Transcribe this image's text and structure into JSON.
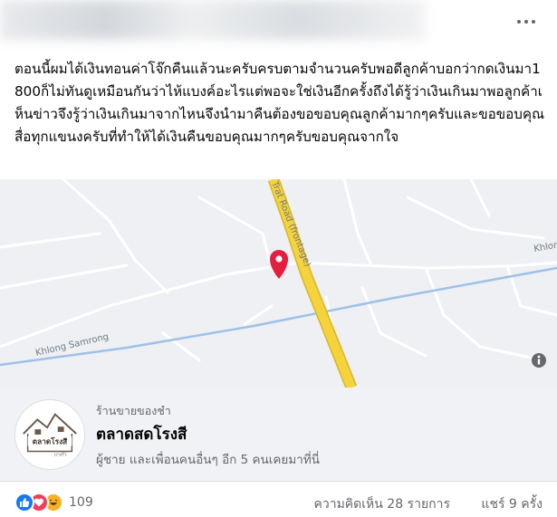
{
  "post": {
    "text": "ตอนนี้ผมได้เงินทอนค่าโจ๊กคืนแล้วนะครับครบตามจำนวนครับพอดีลูกค้าบอกว่ากดเงินมา1800ก็ไม่ทันดูเหมือนกันว่าไห้แบงค์อะไรแต่พอจะใช่เงินอีกครั้งถึงได้รู้ว่าเงินเกินมาพอลูกค้าเห็นข่าวจึงรู้ว่าเงินเกินมาจากไหนจึงนำมาคืนต้องขอขอบคุณลูกค้ามากๆครับและขอขอบคุณสื่อทุกแขนงครับที่ทำให้ได้เงินคืนขอบคุณมากๆครับขอบคุณจากใจ"
  },
  "map": {
    "road_trat": "Trat Road (frontage)",
    "road_khlong_samrong": "Khlong Samrong",
    "road_right_edge": "Khlon",
    "colors": {
      "pin": "#e41e3f",
      "highway": "#f5d33a",
      "water": "#9ec1e8"
    }
  },
  "place": {
    "category": "ร้านขายของชำ",
    "name": "ตลาดสดโรงสี",
    "visitors": "ผู้ชาย และเพื่อนคนอื่นๆ อีก 5 คนเคยมาที่นี่",
    "logo_text": "ตลาดโรงสี",
    "logo_subtext": "บางรัว"
  },
  "stats": {
    "reaction_count": "109",
    "comments": "ความคิดเห็น 28 รายการ",
    "shares": "แชร์ 9 ครั้ง",
    "reactions": [
      "like-icon",
      "love-icon",
      "haha-icon"
    ]
  }
}
